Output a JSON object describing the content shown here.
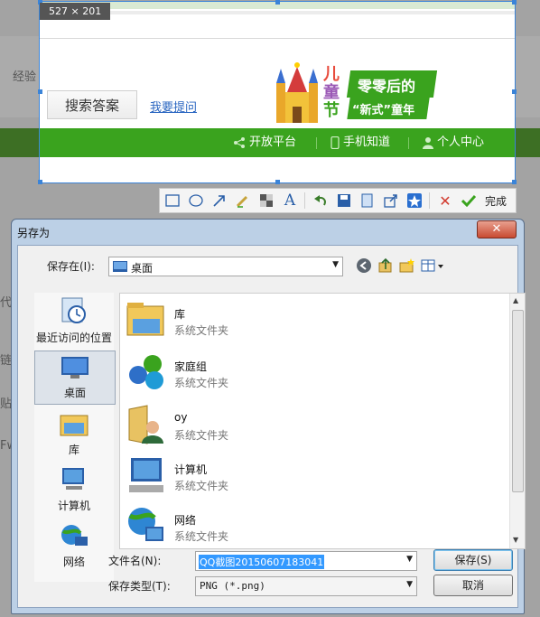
{
  "background": {
    "fragments": [
      "经验",
      "代",
      "链",
      "贴",
      "Fw"
    ]
  },
  "selection": {
    "size_label": "527 × 201",
    "search_button": "搜索答案",
    "ask_link": "我要提问",
    "logo": {
      "left_chars": [
        "儿",
        "童",
        "节"
      ],
      "slogan_line1": "零零后的",
      "slogan_line2": "“新式”童年"
    },
    "nav": [
      {
        "label": "开放平台",
        "icon": "share-icon"
      },
      {
        "label": "手机知道",
        "icon": "phone-icon"
      },
      {
        "label": "个人中心",
        "icon": "person-icon"
      }
    ]
  },
  "toolbar": {
    "tools": [
      "rectangle-icon",
      "ellipse-icon",
      "arrow-icon",
      "brush-icon",
      "mosaic-icon",
      "text-icon",
      "undo-icon",
      "save-icon",
      "copy-icon",
      "share-icon",
      "favorite-icon",
      "cancel-icon",
      "confirm-icon"
    ],
    "done_label": "完成"
  },
  "dialog": {
    "title": "另存为",
    "save_in_label": "保存在(I):",
    "save_in_value": "桌面",
    "places": [
      {
        "label": "最近访问的位置",
        "icon": "recent-places-icon"
      },
      {
        "label": "桌面",
        "icon": "desktop-icon"
      },
      {
        "label": "库",
        "icon": "library-icon"
      },
      {
        "label": "计算机",
        "icon": "computer-icon"
      },
      {
        "label": "网络",
        "icon": "network-icon"
      }
    ],
    "files": [
      {
        "name": "库",
        "type": "系统文件夹",
        "icon": "library-icon"
      },
      {
        "name": "家庭组",
        "type": "系统文件夹",
        "icon": "homegroup-icon"
      },
      {
        "name": "oy",
        "type": "系统文件夹",
        "icon": "user-folder-icon"
      },
      {
        "name": "计算机",
        "type": "系统文件夹",
        "icon": "computer-icon"
      },
      {
        "name": "网络",
        "type": "系统文件夹",
        "icon": "network-icon"
      }
    ],
    "filename_label": "文件名(N):",
    "filename_value": "QQ截图20150607183041",
    "filetype_label": "保存类型(T):",
    "filetype_value": "PNG (*.png)",
    "save_button": "保存(S)",
    "cancel_button": "取消"
  },
  "colors": {
    "accent_green": "#3aa31e",
    "selection_blue": "#3b84d8",
    "dialog_frame": "#bcd0e6",
    "close_red": "#c84a31"
  }
}
